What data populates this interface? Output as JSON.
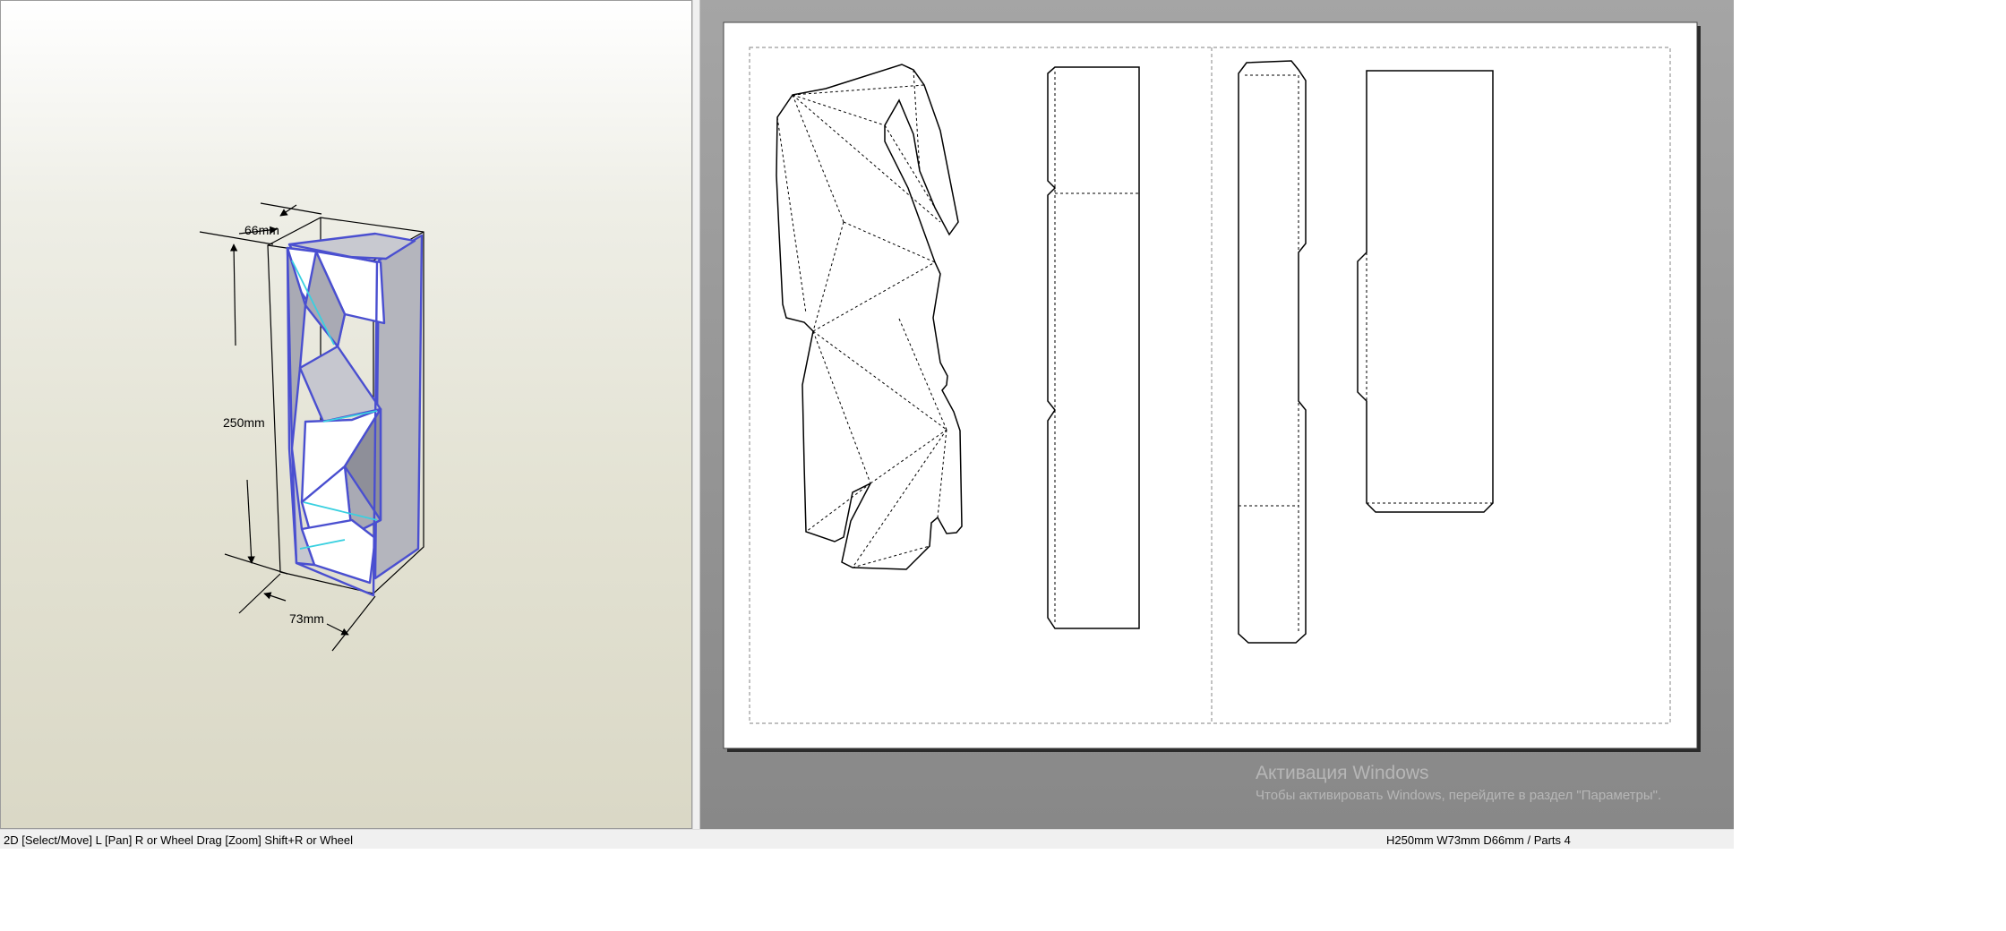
{
  "viewer3d": {
    "dimensions": {
      "depth": "66mm",
      "height": "250mm",
      "width": "73mm"
    },
    "colors": {
      "edge_outline": "#4a4fd0",
      "fold_highlight": "#39d0e0",
      "face_shade": "#a9aab4"
    }
  },
  "viewer2d": {
    "parts_count_shown": 4
  },
  "watermark": {
    "title": "Активация Windows",
    "subtitle": "Чтобы активировать Windows, перейдите в раздел \"Параметры\"."
  },
  "status": {
    "hint": "2D [Select/Move] L [Pan] R or Wheel Drag [Zoom] Shift+R or Wheel",
    "info": "H250mm W73mm D66mm / Parts 4"
  }
}
